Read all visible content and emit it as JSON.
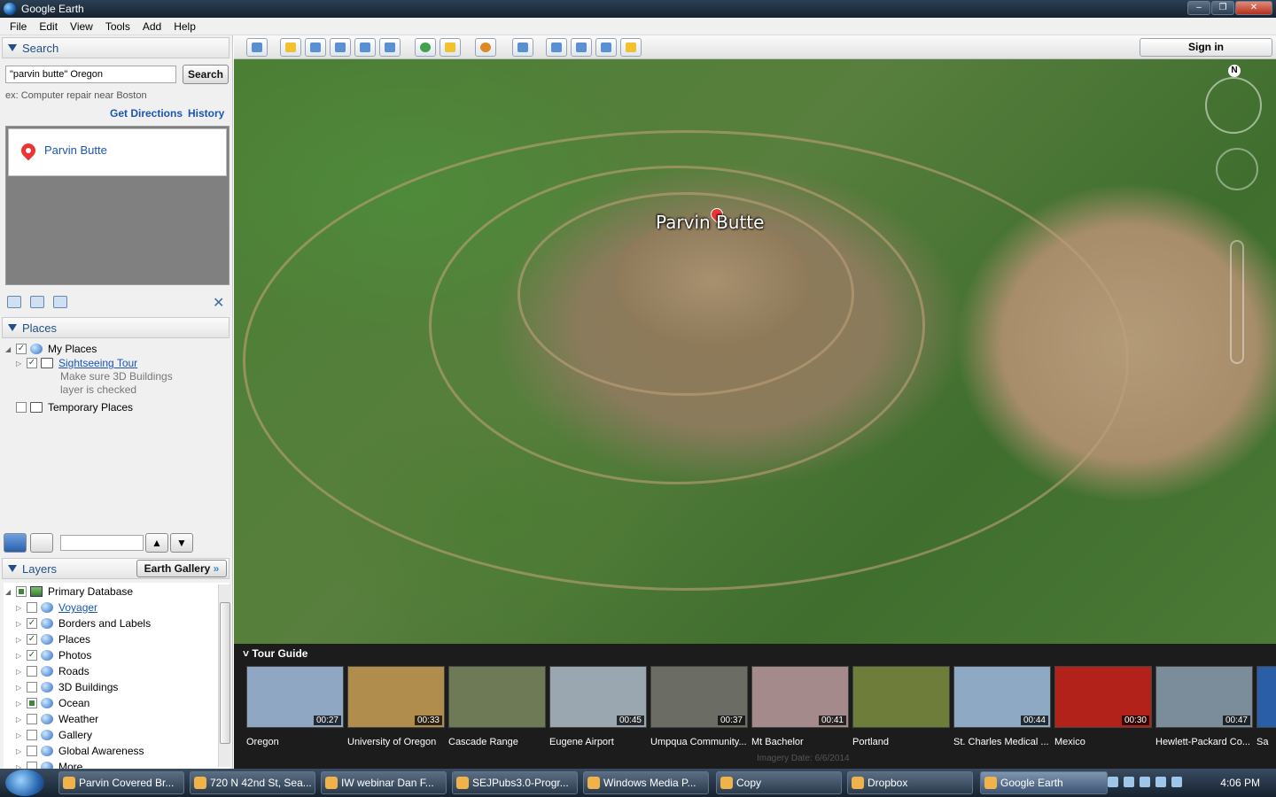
{
  "window": {
    "title": "Google Earth"
  },
  "menu": [
    "File",
    "Edit",
    "View",
    "Tools",
    "Add",
    "Help"
  ],
  "search": {
    "header": "Search",
    "query": "\"parvin butte\" Oregon",
    "button": "Search",
    "hint": "ex: Computer repair near Boston",
    "get_directions": "Get Directions",
    "history": "History",
    "result": "Parvin Butte"
  },
  "places": {
    "header": "Places",
    "my_places": "My Places",
    "sightseeing": "Sightseeing Tour",
    "note_line1": "Make sure 3D Buildings",
    "note_line2": "layer is checked",
    "temporary": "Temporary Places"
  },
  "layers": {
    "header": "Layers",
    "earth_gallery": "Earth Gallery",
    "primary": "Primary Database",
    "items": [
      {
        "label": "Voyager",
        "checked": false,
        "link": true,
        "icon": "voyager-icon"
      },
      {
        "label": "Borders and Labels",
        "checked": true,
        "icon": "flag-icon"
      },
      {
        "label": "Places",
        "checked": true,
        "icon": "places-icon"
      },
      {
        "label": "Photos",
        "checked": true,
        "icon": "photos-icon"
      },
      {
        "label": "Roads",
        "checked": false,
        "icon": "roads-icon"
      },
      {
        "label": "3D Buildings",
        "checked": false,
        "icon": "buildings-icon"
      },
      {
        "label": "Ocean",
        "checked": "partial",
        "icon": "ocean-icon"
      },
      {
        "label": "Weather",
        "checked": false,
        "icon": "weather-icon"
      },
      {
        "label": "Gallery",
        "checked": false,
        "icon": "gallery-icon"
      },
      {
        "label": "Global Awareness",
        "checked": false,
        "icon": "globe-icon"
      },
      {
        "label": "More",
        "checked": false,
        "icon": "folder-icon"
      }
    ]
  },
  "toolbar": {
    "sign_in": "Sign in"
  },
  "map": {
    "label": "Parvin Butte",
    "compass": "N"
  },
  "tour": {
    "header": "Tour Guide",
    "items": [
      {
        "label": "Oregon",
        "duration": "00:27",
        "color": "#8fa7c2"
      },
      {
        "label": "University of Oregon",
        "duration": "00:33",
        "color": "#b08d4d"
      },
      {
        "label": "Cascade Range",
        "duration": "",
        "color": "#6d7a55"
      },
      {
        "label": "Eugene Airport",
        "duration": "00:45",
        "color": "#9aa7b0"
      },
      {
        "label": "Umpqua Community...",
        "duration": "00:37",
        "color": "#6b6d64"
      },
      {
        "label": "Mt Bachelor",
        "duration": "00:41",
        "color": "#a58a8b"
      },
      {
        "label": "Portland",
        "duration": "",
        "color": "#6f7d3a"
      },
      {
        "label": "St. Charles Medical ...",
        "duration": "00:44",
        "color": "#8ea9c4"
      },
      {
        "label": "Mexico",
        "duration": "00:30",
        "color": "#b3221a"
      },
      {
        "label": "Hewlett-Packard Co...",
        "duration": "00:47",
        "color": "#7b8c9b"
      },
      {
        "label": "Sa",
        "duration": "",
        "color": "#2a5fa8"
      }
    ],
    "status": "Imagery Date: 6/6/2014"
  },
  "taskbar": {
    "items": [
      "Parvin Covered Br...",
      "720 N 42nd St, Sea...",
      "IW webinar Dan F...",
      "SEJPubs3.0-Progr...",
      "Windows Media P...",
      "Copy",
      "Dropbox",
      "Google Earth"
    ],
    "time": "4:06 PM"
  }
}
